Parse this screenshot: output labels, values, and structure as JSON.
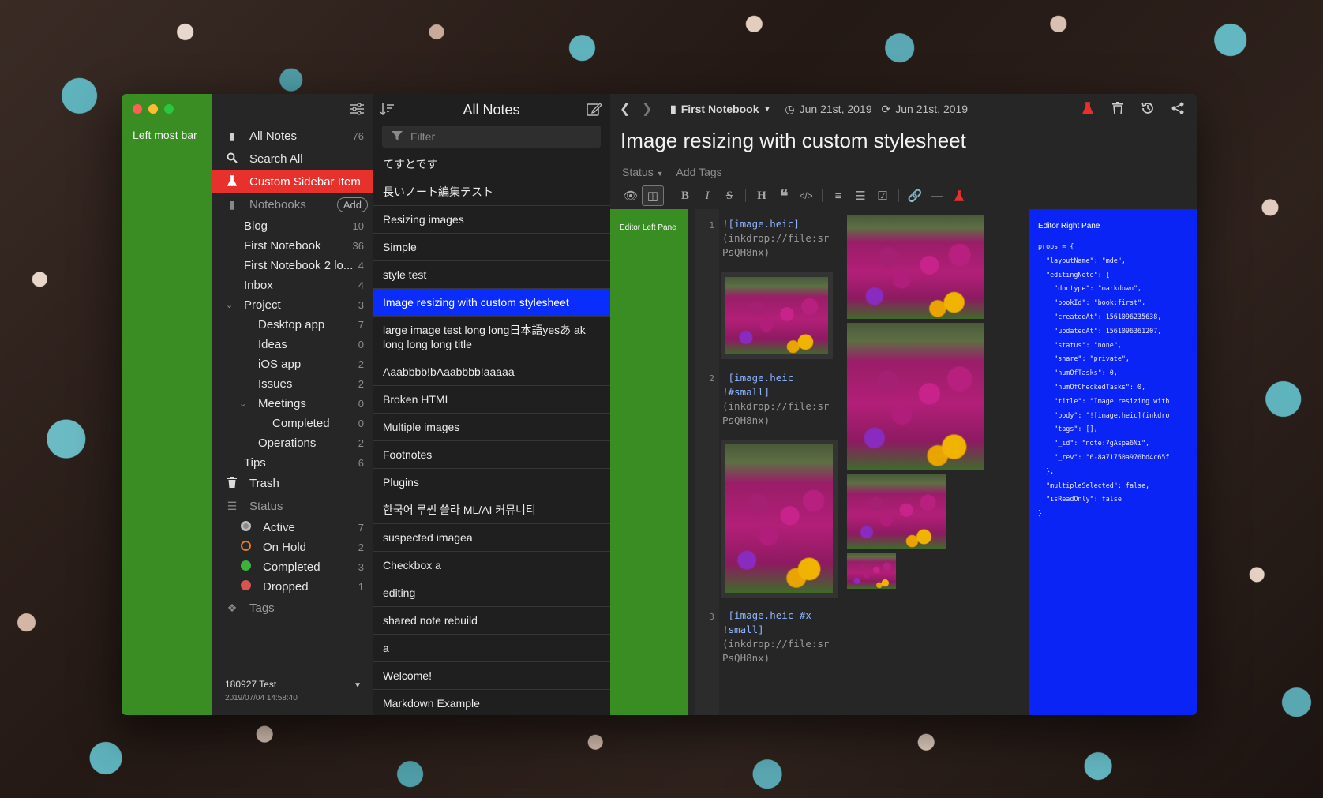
{
  "window": {
    "left_bar_label": "Left most bar"
  },
  "sidebar": {
    "items": [
      {
        "label": "All Notes",
        "count": "76"
      },
      {
        "label": "Search All"
      },
      {
        "label": "Custom Sidebar Item"
      }
    ],
    "notebooks_header": "Notebooks",
    "add_label": "Add",
    "notebooks": [
      {
        "label": "Blog",
        "count": "10"
      },
      {
        "label": "First Notebook",
        "count": "36"
      },
      {
        "label": "First Notebook 2 lo...",
        "count": "4"
      },
      {
        "label": "Inbox",
        "count": "4"
      },
      {
        "label": "Project",
        "count": "3"
      },
      {
        "label": "Desktop app",
        "count": "7"
      },
      {
        "label": "Ideas",
        "count": "0"
      },
      {
        "label": "iOS app",
        "count": "2"
      },
      {
        "label": "Issues",
        "count": "2"
      },
      {
        "label": "Meetings",
        "count": "0"
      },
      {
        "label": "Completed",
        "count": "0"
      },
      {
        "label": "Operations",
        "count": "2"
      },
      {
        "label": "Tips",
        "count": "6"
      }
    ],
    "trash_label": "Trash",
    "status_header": "Status",
    "statuses": [
      {
        "label": "Active",
        "count": "7",
        "color": "#8a8a8a"
      },
      {
        "label": "On Hold",
        "count": "2",
        "color": "#e07b2c"
      },
      {
        "label": "Completed",
        "count": "3",
        "color": "#3bb33b"
      },
      {
        "label": "Dropped",
        "count": "1",
        "color": "#d9534f"
      }
    ],
    "tags_header": "Tags",
    "footer": {
      "name": "180927 Test",
      "date": "2019/07/04 14:58:40"
    }
  },
  "notelist": {
    "title": "All Notes",
    "filter_placeholder": "Filter",
    "notes": [
      "てすとです",
      "長いノート編集テスト",
      "Resizing images",
      "Simple",
      "style test",
      "Image resizing with custom stylesheet",
      "large image test long long日本語yesあ ak long long long title",
      "Aaabbbb!bAaabbbb!aaaaa",
      "Broken HTML",
      "Multiple images",
      "Footnotes",
      "Plugins",
      "한국어 루씬 쓸라 ML/AI 커뮤니티",
      "suspected imagea",
      "Checkbox a",
      "editing",
      "shared note rebuild",
      "a",
      "Welcome!",
      "Markdown Example"
    ],
    "selected_index": 5
  },
  "editor": {
    "notebook": "First Notebook",
    "created": "Jun 21st, 2019",
    "updated": "Jun 21st, 2019",
    "title": "Image resizing with custom stylesheet",
    "status_label": "Status",
    "add_tags_label": "Add Tags",
    "left_pane_label": "Editor Left Pane",
    "right_pane_label": "Editor Right Pane",
    "code_lines": [
      {
        "num": "1",
        "alt": "[image.heic]",
        "url": "(inkdrop://file:srPsQH8nx)"
      },
      {
        "num": "2",
        "alt": "[image.heic #small]",
        "url": "(inkdrop://file:srPsQH8nx)"
      },
      {
        "num": "3",
        "alt": "[image.heic #x-small]",
        "url": "(inkdrop://file:srPsQH8nx)"
      }
    ],
    "props_dump": "props = {\n  \"layoutName\": \"mde\",\n  \"editingNote\": {\n    \"doctype\": \"markdown\",\n    \"bookId\": \"book:first\",\n    \"createdAt\": 1561096235638,\n    \"updatedAt\": 1561096361207,\n    \"status\": \"none\",\n    \"share\": \"private\",\n    \"numOfTasks\": 0,\n    \"numOfCheckedTasks\": 0,\n    \"title\": \"Image resizing with\n    \"body\": \"![image.heic](inkdro\n    \"tags\": [],\n    \"_id\": \"note:7gAspa6Ni\",\n    \"_rev\": \"6-8a71750a976bd4c65f\n  },\n  \"multipleSelected\": false,\n  \"isReadOnly\": false\n}"
  },
  "colors": {
    "accent_red": "#e8302d",
    "selected_blue": "#0a2dfb",
    "left_green": "#3a8d22",
    "right_pane_blue": "#0a24f5"
  }
}
